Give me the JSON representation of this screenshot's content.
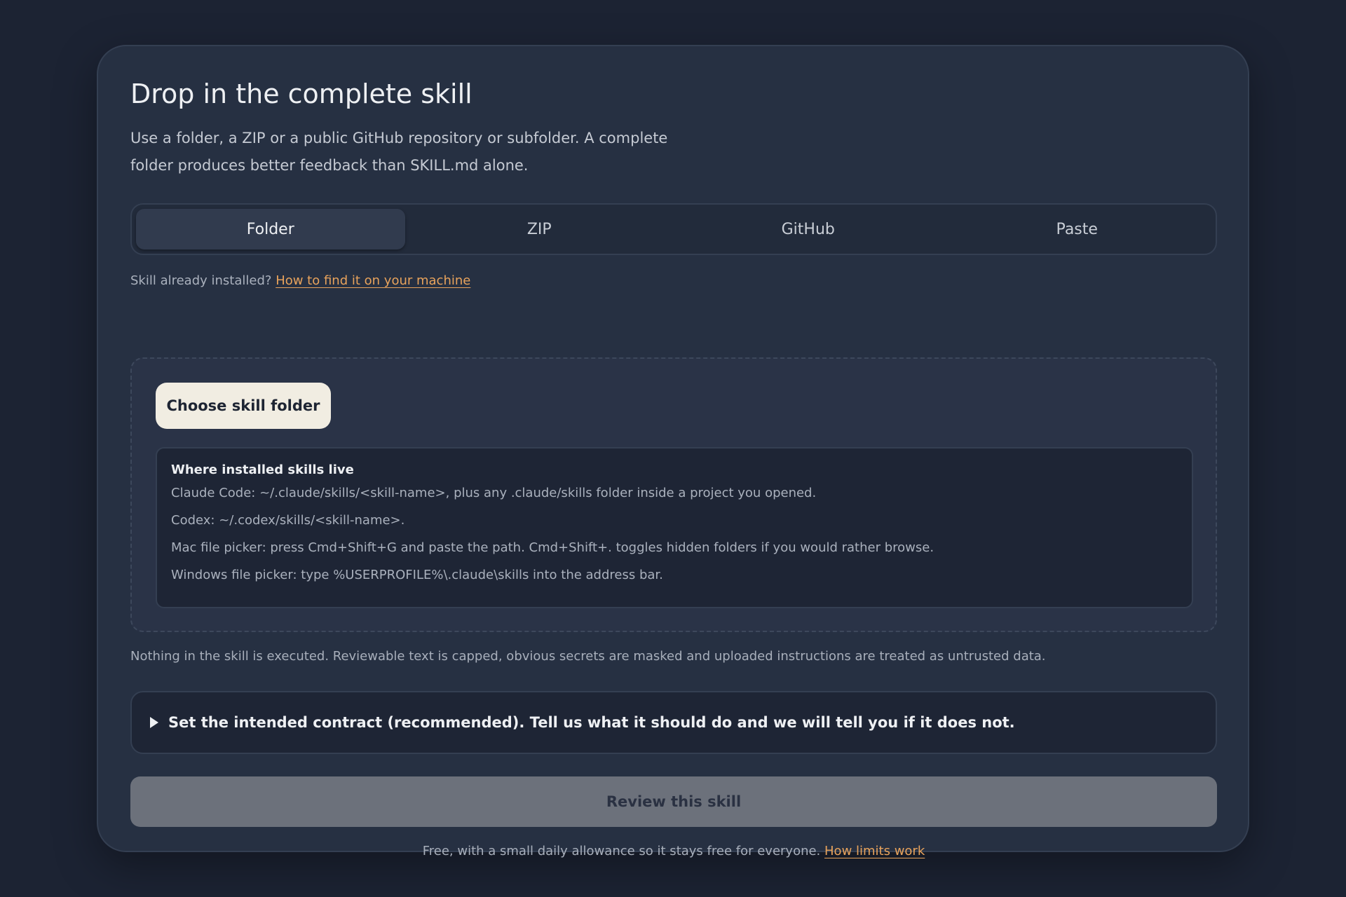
{
  "card": {
    "title": "Drop in the complete skill",
    "subtitle": "Use a folder, a ZIP or a public GitHub repository or subfolder. A complete folder produces better feedback than SKILL.md alone."
  },
  "tabs": [
    {
      "label": "Folder",
      "active": true
    },
    {
      "label": "ZIP",
      "active": false
    },
    {
      "label": "GitHub",
      "active": false
    },
    {
      "label": "Paste",
      "active": false
    }
  ],
  "hint": {
    "text": "Skill already installed?",
    "link": "How to find it on your machine"
  },
  "dropzone": {
    "button_label": "Choose skill folder",
    "info_title": "Where installed skills live",
    "info_lines": [
      "Claude Code: ~/.claude/skills/<skill-name>, plus any .claude/skills folder inside a project you opened.",
      "Codex: ~/.codex/skills/<skill-name>.",
      "Mac file picker: press Cmd+Shift+G and paste the path. Cmd+Shift+. toggles hidden folders if you would rather browse.",
      "Windows file picker: type %USERPROFILE%\\.claude\\skills into the address bar."
    ]
  },
  "note": "Nothing in the skill is executed. Reviewable text is capped, obvious secrets are masked and uploaded instructions are treated as untrusted data.",
  "contract": {
    "label": "Set the intended contract (recommended). Tell us what it should do and we will tell you if it does not.",
    "icon": "disclosure-triangle-icon"
  },
  "review_button": "Review this skill",
  "footer": {
    "text": "Free, with a small daily allowance so it stays free for everyone.",
    "link": "How limits work"
  },
  "colors": {
    "page_bg": "#1c2333",
    "card_bg": "#263042",
    "accent_link": "#e8a35c",
    "primary_button_bg": "#f1ede2",
    "disabled_button_bg": "#6c717b"
  }
}
